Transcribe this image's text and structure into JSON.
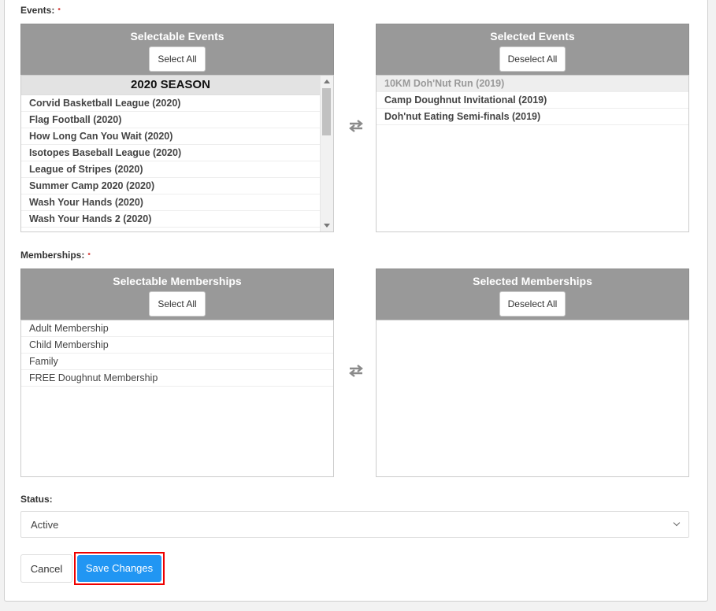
{
  "events": {
    "label": "Events:",
    "required_mark": "•",
    "selectable": {
      "title": "Selectable Events",
      "button": "Select All",
      "group": "2020 SEASON",
      "items": [
        "Corvid Basketball League (2020)",
        "Flag Football (2020)",
        "How Long Can You Wait (2020)",
        "Isotopes Baseball League (2020)",
        "League of Stripes (2020)",
        "Summer Camp 2020 (2020)",
        "Wash Your Hands (2020)",
        "Wash Your Hands 2 (2020)"
      ]
    },
    "selected": {
      "title": "Selected Events",
      "button": "Deselect All",
      "items": [
        "10KM Doh'Nut Run (2019)",
        "Camp Doughnut Invitational (2019)",
        "Doh'nut Eating Semi-finals (2019)"
      ]
    }
  },
  "memberships": {
    "label": "Memberships:",
    "required_mark": "•",
    "selectable": {
      "title": "Selectable Memberships",
      "button": "Select All",
      "items": [
        "Adult Membership",
        "Child Membership",
        "Family",
        "FREE Doughnut Membership"
      ]
    },
    "selected": {
      "title": "Selected Memberships",
      "button": "Deselect All",
      "items": []
    }
  },
  "status": {
    "label": "Status:",
    "value": "Active"
  },
  "actions": {
    "cancel": "Cancel",
    "save": "Save Changes"
  },
  "colors": {
    "primary": "#2196f3",
    "header_gray": "#999999",
    "highlight": "#e00000"
  }
}
